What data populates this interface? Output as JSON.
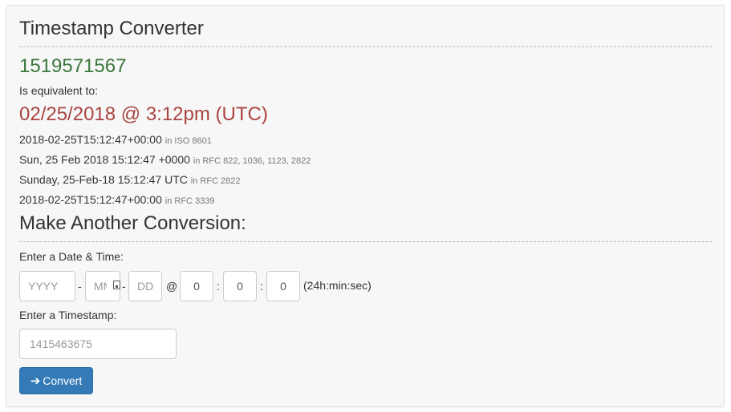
{
  "converter": {
    "title": "Timestamp Converter",
    "timestamp": "1519571567",
    "equivalent_label": "Is equivalent to:",
    "human_date": "02/25/2018 @ 3:12pm (UTC)",
    "formats": [
      {
        "value": "2018-02-25T15:12:47+00:00",
        "standard": "in ISO 8601"
      },
      {
        "value": "Sun, 25 Feb 2018 15:12:47 +0000",
        "standard": "in RFC 822, 1036, 1123, 2822"
      },
      {
        "value": "Sunday, 25-Feb-18 15:12:47 UTC",
        "standard": "in RFC 2822"
      },
      {
        "value": "2018-02-25T15:12:47+00:00",
        "standard": "in RFC 3339"
      }
    ]
  },
  "form": {
    "title": "Make Another Conversion:",
    "date_label": "Enter a Date & Time:",
    "year_placeholder": "YYYY",
    "month_placeholder": "MM",
    "day_placeholder": "DD",
    "hour_value": "0",
    "minute_value": "0",
    "second_value": "0",
    "dash": "-",
    "at": "@",
    "colon": ":",
    "time_hint": "(24h:min:sec)",
    "timestamp_label": "Enter a Timestamp:",
    "timestamp_placeholder": "1415463675",
    "convert_label": "Convert",
    "convert_icon": "arrow-right-icon"
  },
  "colors": {
    "timestamp": "#3c763d",
    "human_date": "#a94442",
    "button": "#337ab7"
  }
}
